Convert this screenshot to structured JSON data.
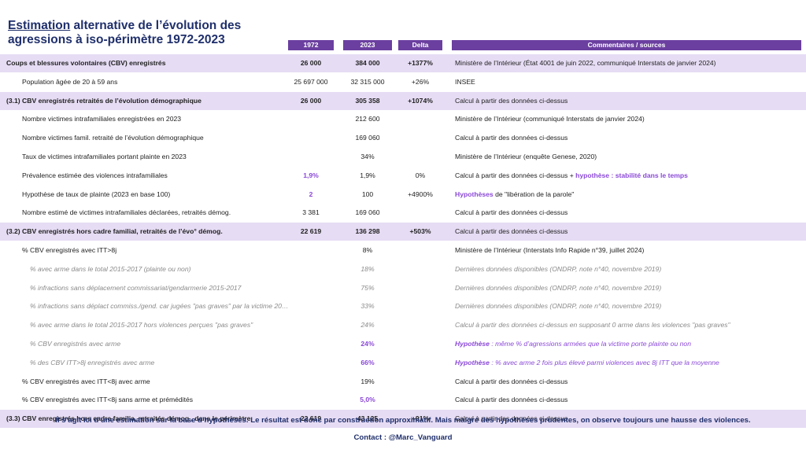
{
  "title": {
    "underlined": "Estimation",
    "rest": " alternative de l’évolution des agressions à iso-périmètre 1972-2023"
  },
  "headers": {
    "y1972": "1972",
    "y2023": "2023",
    "delta": "Delta",
    "comments": "Commentaires / sources"
  },
  "rows": [
    {
      "style": "band",
      "level": 0,
      "label": "Coups et blessures volontaires (CBV) enregistrés",
      "v1972": "26 000",
      "v2023": "384 000",
      "delta": "+1377%",
      "comment": "Ministère de l’Intérieur (État 4001 de juin 2022, communiqué Interstats de janvier 2024)"
    },
    {
      "style": "",
      "level": 1,
      "label": "Population âgée de 20 à 59 ans",
      "v1972": "25 697 000",
      "v2023": "32 315 000",
      "delta": "+26%",
      "comment": "INSEE"
    },
    {
      "style": "band",
      "level": 0,
      "label": "(3.1) CBV enregistrés retraités de l’évolution démographique",
      "v1972": "26 000",
      "v2023": "305 358",
      "delta": "+1074%",
      "comment": "Calcul à partir des données ci-dessus"
    },
    {
      "style": "",
      "level": 1,
      "label": "Nombre victimes intrafamiliales enregistrées en 2023",
      "v1972": "",
      "v2023": "212 600",
      "delta": "",
      "comment": "Ministère de l’Intérieur (communiqué Interstats de janvier 2024)"
    },
    {
      "style": "",
      "level": 1,
      "label": "Nombre victimes famil. retraité de l’évolution démographique",
      "v1972": "",
      "v2023": "169 060",
      "delta": "",
      "comment": "Calcul à partir des données ci-dessus"
    },
    {
      "style": "",
      "level": 1,
      "label": "Taux de victimes intrafamiliales portant plainte en 2023",
      "v1972": "",
      "v2023": "34%",
      "delta": "",
      "comment": "Ministère de l’Intérieur (enquête Genese, 2020)"
    },
    {
      "style": "",
      "level": 1,
      "label": "Prévalence estimée des violences intrafamiliales",
      "v1972": "1,9%",
      "v1972_purple": true,
      "v2023": "1,9%",
      "delta": "0%",
      "comment": "Calcul à partir des données ci-dessus + ",
      "comment_purple": "hypothèse : stabilité dans le temps"
    },
    {
      "style": "",
      "level": 1,
      "label": "Hypothèse de taux de plainte (2023 en base 100)",
      "v1972": "2",
      "v1972_purple": true,
      "v2023": "100",
      "delta": "+4900%",
      "comment_purple_first": "Hypothèses",
      "comment": " de \"libération de la parole\""
    },
    {
      "style": "",
      "level": 1,
      "label": "Nombre estimé de victimes intrafamiliales déclarées, retraités démog.",
      "v1972": "3 381",
      "v2023": "169 060",
      "delta": "",
      "comment": "Calcul à partir des données ci-dessus"
    },
    {
      "style": "band",
      "level": 0,
      "label": "(3.2) CBV enregistrés hors cadre familial, retraités de l’évo° démog.",
      "v1972": "22 619",
      "v2023": "136 298",
      "delta": "+503%",
      "comment": "Calcul à partir des données ci-dessus"
    },
    {
      "style": "",
      "level": 1,
      "label": "% CBV enregistrés avec ITT>8j",
      "v1972": "",
      "v2023": "8%",
      "delta": "",
      "comment": "Ministère de l’Intérieur (Interstats Info Rapide n°39, juillet 2024)"
    },
    {
      "style": "ital",
      "level": 2,
      "label": "% avec arme dans le total 2015-2017 (plainte ou non)",
      "v1972": "",
      "v2023": "18%",
      "delta": "",
      "comment": "Dernières données disponibles (ONDRP, note n°40, novembre 2019)"
    },
    {
      "style": "ital",
      "level": 2,
      "label": "% infractions sans déplacement commissariat/gendarmerie 2015-2017",
      "v1972": "",
      "v2023": "75%",
      "delta": "",
      "comment": "Dernières données disponibles (ONDRP, note n°40, novembre 2019)"
    },
    {
      "style": "ital",
      "level": 2,
      "label": "% infractions sans déplact commiss./gend. car jugées \"pas graves\" par la victime 20…",
      "v1972": "",
      "v2023": "33%",
      "delta": "",
      "comment": "Dernières données disponibles (ONDRP, note n°40, novembre 2019)"
    },
    {
      "style": "ital",
      "level": 2,
      "label": "% avec arme dans le total 2015-2017 hors violences perçues \"pas graves\"",
      "v1972": "",
      "v2023": "24%",
      "delta": "",
      "comment": "Calcul à partir des données ci-dessus en supposant 0 arme dans les violences \"pas graves\""
    },
    {
      "style": "ital",
      "level": 2,
      "label": "% CBV enregistrés avec arme",
      "v1972": "",
      "v2023": "24%",
      "v2023_purple": true,
      "delta": "",
      "comment_purple_first": "Hypothèse",
      "comment": " : même % d’agressions armées que la victime porte plainte ou non",
      "comment_all_purple": true
    },
    {
      "style": "ital",
      "level": 2,
      "label": "% des CBV ITT>8j enregistrés avec arme",
      "v1972": "",
      "v2023": "66%",
      "v2023_purple": true,
      "delta": "",
      "comment_purple_first": "Hypothèse",
      "comment": " : % avec arme 2 fois plus élevé parmi violences avec 8j ITT que la moyenne",
      "comment_all_purple": true
    },
    {
      "style": "",
      "level": 1,
      "label": "% CBV enregistrés avec ITT<8j avec arme",
      "v1972": "",
      "v2023": "19%",
      "delta": "",
      "comment": "Calcul à partir des données ci-dessus"
    },
    {
      "style": "",
      "level": 1,
      "label": "% CBV enregistrés avec ITT<8j sans arme et prémédités",
      "v1972": "",
      "v2023": "5,0%",
      "v2023_purple": true,
      "delta": "",
      "comment": "Calcul à partir des données ci-dessus"
    },
    {
      "style": "band",
      "level": 0,
      "label": "(3.3) CBV enregistrés hors cadre familia, retraités démog., dans le périmètre",
      "v1972": "22 619",
      "v2023": "43 125",
      "delta": "+91%",
      "comment": "Calcul à partir des données ci-dessus"
    }
  ],
  "footer": {
    "note": "Il s’agit ici d’une estimation sur la base d’hypothèses. Le résultat est donc par construction approximatif. Mais malgré des hypothèses prudentes, on observe toujours une hausse des violences.",
    "contact": "Contact : @Marc_Vanguard"
  },
  "colors": {
    "accent": "#6b3fa0",
    "band": "#e6dcf4",
    "highlight": "#8b49d8",
    "title": "#1f2f6b"
  }
}
